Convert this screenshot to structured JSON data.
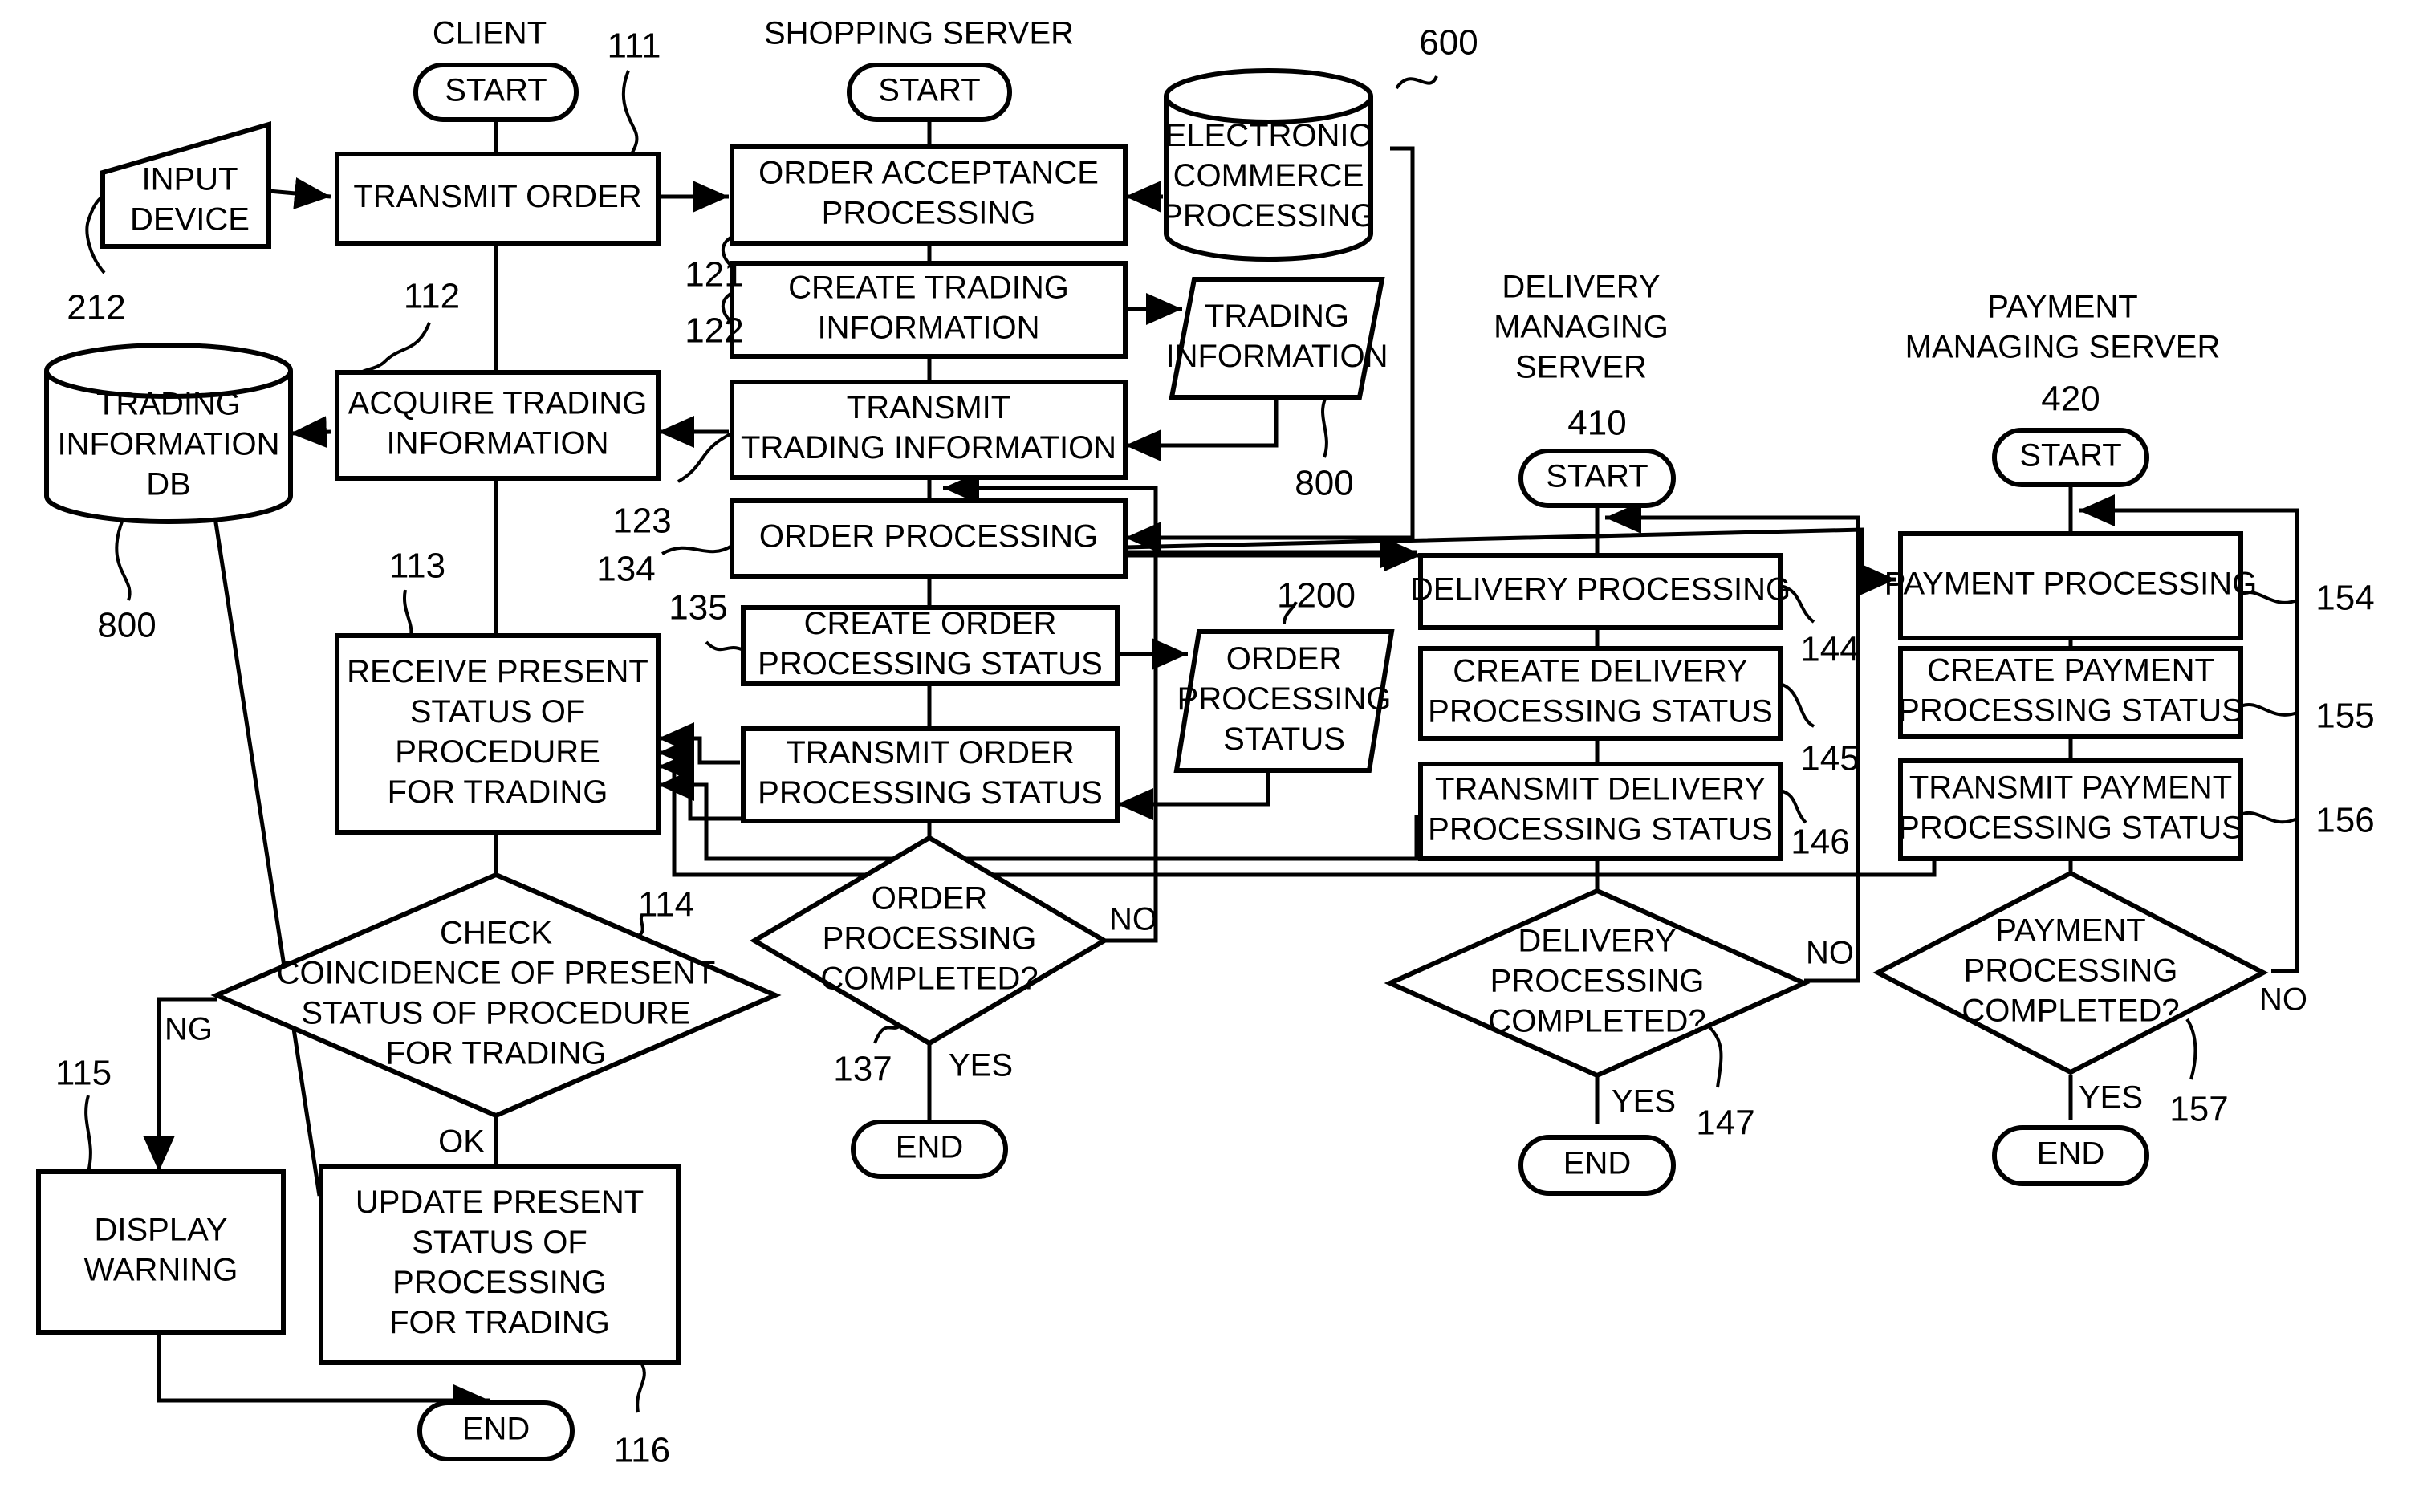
{
  "figure": {
    "lanes": {
      "client": "CLIENT",
      "shopping": "SHOPPING SERVER",
      "delivery": [
        "DELIVERY",
        "MANAGING",
        "SERVER"
      ],
      "payment": [
        "PAYMENT",
        "MANAGING SERVER"
      ]
    },
    "terminals": {
      "client_start": "START",
      "shopping_start": "START",
      "delivery_start": "START",
      "payment_start": "START",
      "client_end": "END",
      "shopping_end": "END",
      "delivery_end": "END",
      "payment_end": "END"
    },
    "processes": {
      "p111": [
        "TRANSMIT ORDER"
      ],
      "p112": [
        "ACQUIRE TRADING",
        "INFORMATION"
      ],
      "p113": [
        "RECEIVE PRESENT",
        "STATUS OF",
        "PROCEDURE",
        "FOR TRADING"
      ],
      "p115": [
        "DISPLAY",
        "WARNING"
      ],
      "p116": [
        "UPDATE PRESENT",
        "STATUS OF",
        "PROCESSING",
        "FOR TRADING"
      ],
      "p121": [
        "ORDER ACCEPTANCE",
        "PROCESSING"
      ],
      "p122": [
        "CREATE TRADING",
        "INFORMATION"
      ],
      "p123": [
        "TRANSMIT",
        "TRADING INFORMATION"
      ],
      "p134": [
        "ORDER PROCESSING"
      ],
      "p135": [
        "CREATE ORDER",
        "PROCESSING STATUS"
      ],
      "p136": [
        "TRANSMIT ORDER",
        "PROCESSING STATUS"
      ],
      "p144": [
        "DELIVERY PROCESSING"
      ],
      "p145": [
        "CREATE DELIVERY",
        "PROCESSING STATUS"
      ],
      "p146": [
        "TRANSMIT DELIVERY",
        "PROCESSING STATUS"
      ],
      "p154": [
        "PAYMENT PROCESSING"
      ],
      "p155": [
        "CREATE PAYMENT",
        "PROCESSING STATUS"
      ],
      "p156": [
        "TRANSMIT PAYMENT",
        "PROCESSING STATUS"
      ]
    },
    "decisions": {
      "d114": [
        "CHECK",
        "COINCIDENCE OF PRESENT",
        "STATUS OF PROCEDURE",
        "FOR TRADING"
      ],
      "d137": [
        "ORDER",
        "PROCESSING",
        "COMPLETED?"
      ],
      "d147": [
        "DELIVERY",
        "PROCESSING",
        "COMPLETED?"
      ],
      "d157": [
        "PAYMENT",
        "PROCESSING",
        "COMPLETED?"
      ]
    },
    "stores": {
      "input_device": [
        "INPUT",
        "DEVICE"
      ],
      "trading_db": [
        "TRADING",
        "INFORMATION",
        "DB"
      ],
      "ec_processing": [
        "ELECTRONIC",
        "COMMERCE",
        "PROCESSING"
      ],
      "trading_info_data": [
        "TRADING",
        "INFORMATION"
      ],
      "order_status_data": [
        "ORDER",
        "PROCESSING",
        "STATUS"
      ]
    },
    "branch_labels": {
      "ng": "NG",
      "ok": "OK",
      "no_137": "NO",
      "yes_137": "YES",
      "no_147": "NO",
      "yes_147": "YES",
      "no_157": "NO",
      "yes_157": "YES"
    },
    "refs": {
      "r111": "111",
      "r112": "112",
      "r113": "113",
      "r114": "114",
      "r115": "115",
      "r116": "116",
      "r121": "121",
      "r122": "122",
      "r123": "123",
      "r134": "134",
      "r135": "135",
      "r137": "137",
      "r144": "144",
      "r145": "145",
      "r146": "146",
      "r147": "147",
      "r154": "154",
      "r155": "155",
      "r156": "156",
      "r157": "157",
      "r212": "212",
      "r600": "600",
      "r800a": "800",
      "r800b": "800",
      "r1200": "1200",
      "r410": "410",
      "r420": "420"
    }
  }
}
